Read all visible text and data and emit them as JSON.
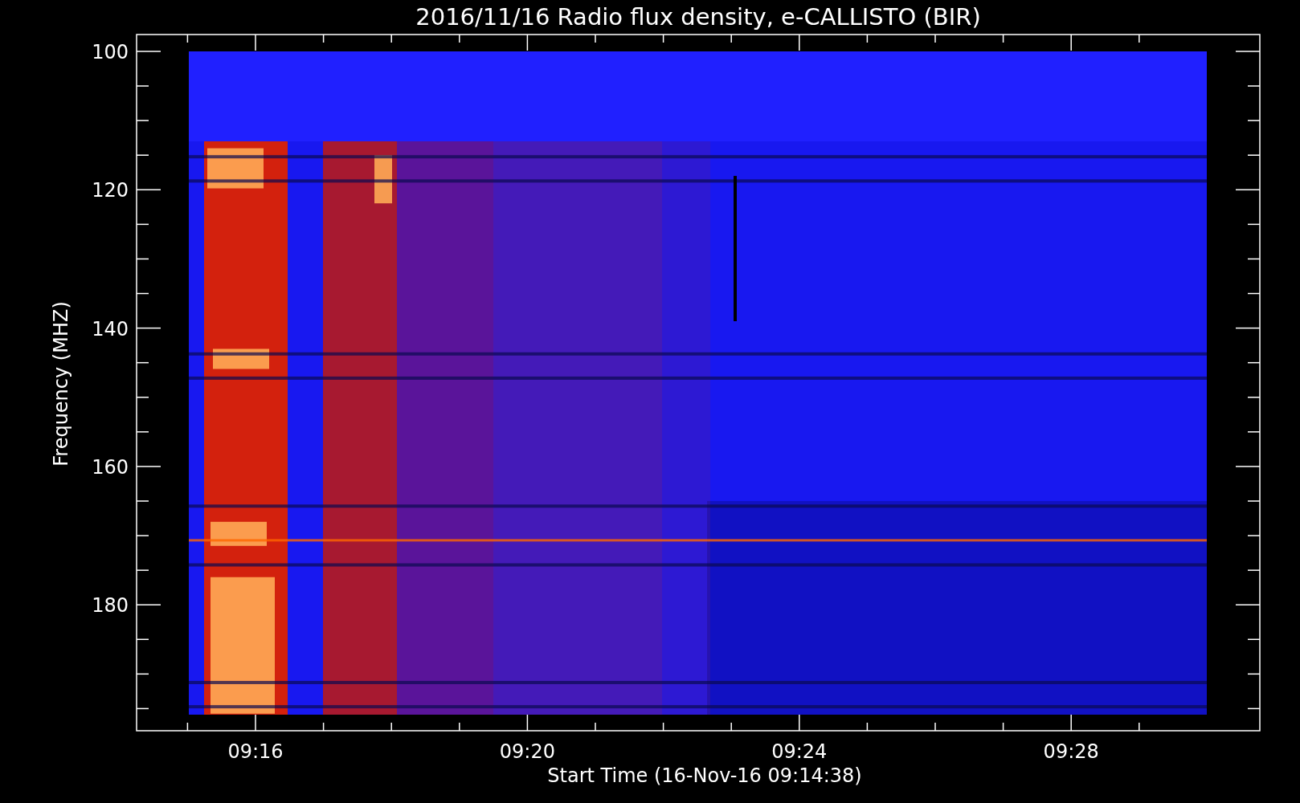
{
  "title": "2016/11/16  Radio flux density, e-CALLISTO (BIR)",
  "y_axis": {
    "label": "Frequency (MHZ)",
    "ticks": [
      "100",
      "120",
      "140",
      "160",
      "180"
    ]
  },
  "x_axis": {
    "label": "Start Time (16-Nov-16 09:14:38)",
    "ticks": [
      "09:16",
      "09:20",
      "09:24",
      "09:28"
    ]
  }
}
